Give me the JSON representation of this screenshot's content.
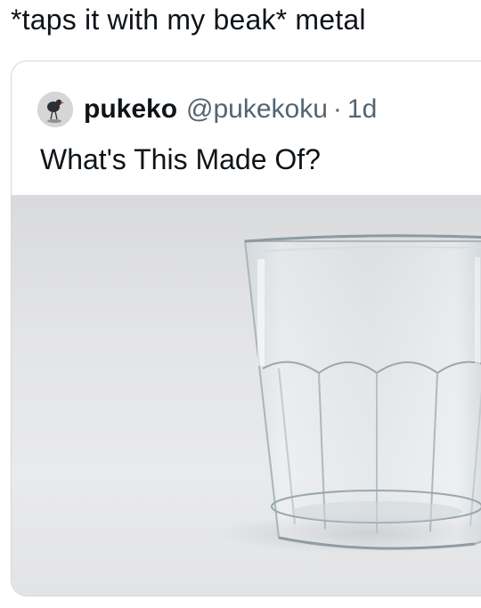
{
  "post": {
    "text": "*taps it with my beak* metal"
  },
  "quoted_tweet": {
    "display_name": "pukeko",
    "handle": "@pukekoku",
    "separator": "·",
    "timestamp": "1d",
    "text": "What's This Made Of?",
    "avatar_icon": "pukeko-bird-avatar-icon",
    "media_subject": "glass-tumbler"
  }
}
